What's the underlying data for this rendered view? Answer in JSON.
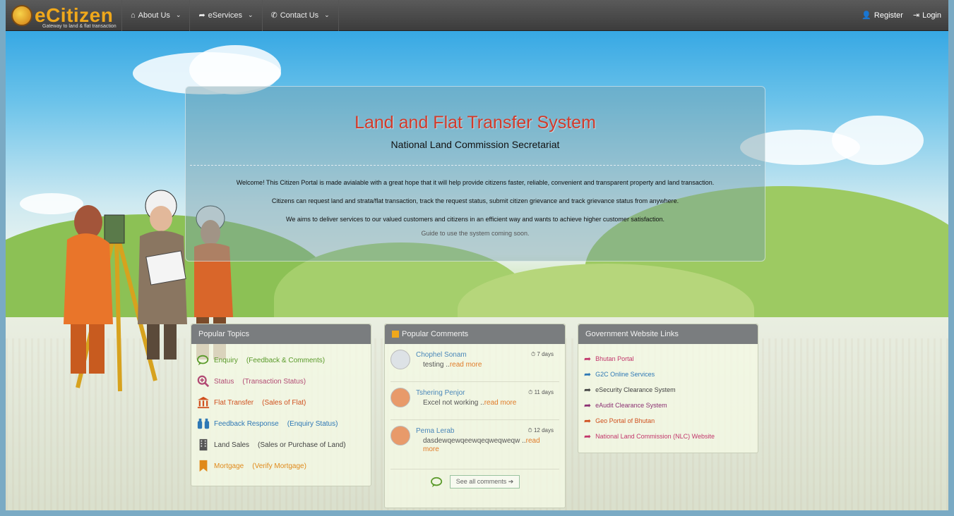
{
  "nav": {
    "brand_name": "eCitizen",
    "brand_tagline": "Gateway to land & flat transaction",
    "menu": [
      {
        "label": "About Us"
      },
      {
        "label": "eServices"
      },
      {
        "label": "Contact Us"
      }
    ],
    "register_label": "Register",
    "login_label": "Login"
  },
  "intro": {
    "title": "Land and Flat Transfer System",
    "subtitle": "National Land Commission Secretariat",
    "paragraphs": [
      "Welcome! This Citizen Portal is made avialable with a great hope that it will help provide citizens faster, reliable, convenient and transparent property and land transaction.",
      "Citizens can request land and strata/flat transaction, track the request status, submit citizen grievance and track grievance status from anywhere.",
      "We aims to deliver services to our valued customers and citizens in an efficient way and wants to achieve higher customer satisfaction."
    ],
    "guide": "Guide to use the system coming soon."
  },
  "popular_topics": {
    "heading": "Popular Topics",
    "items": [
      {
        "label": "Enquiry",
        "sub": "(Feedback & Comments)",
        "color": "#5a9a2a",
        "icon": "chat-icon"
      },
      {
        "label": "Status",
        "sub": "(Transaction Status)",
        "color": "#b24b74",
        "icon": "zoom-icon"
      },
      {
        "label": "Flat Transfer",
        "sub": "(Sales of Flat)",
        "color": "#d0501e",
        "icon": "bank-icon"
      },
      {
        "label": "Feedback Response",
        "sub": "(Enquiry Status)",
        "color": "#2e78b5",
        "icon": "binoculars-icon"
      },
      {
        "label": "Land Sales",
        "sub": "(Sales or Purchase of Land)",
        "color": "#555555",
        "icon": "building-icon"
      },
      {
        "label": "Mortgage",
        "sub": "(Verify Mortgage)",
        "color": "#e08a1b",
        "icon": "bookmark-icon"
      }
    ]
  },
  "popular_comments": {
    "heading": "Popular Comments",
    "items": [
      {
        "name": "Chophel Sonam",
        "days": "7 days",
        "text": "testing ..",
        "more": "read more"
      },
      {
        "name": "Tshering Penjor",
        "days": "11 days",
        "text": "Excel not working ..",
        "more": "read more"
      },
      {
        "name": "Pema Lerab",
        "days": "12 days",
        "text": "dasdewqewqeewqeqweqweqw ..",
        "more": "read more"
      }
    ],
    "see_all": "See all comments"
  },
  "gov_links": {
    "heading": "Government Website Links",
    "items": [
      {
        "label": "Bhutan Portal",
        "color": "#c2366b"
      },
      {
        "label": "G2C Online Services",
        "color": "#2e78b5"
      },
      {
        "label": "eSecurity Clearance System",
        "color": "#444444"
      },
      {
        "label": "eAudit Clearance System",
        "color": "#8b2f72"
      },
      {
        "label": "Geo Portal of Bhutan",
        "color": "#d0501e"
      },
      {
        "label": "National Land Commission (NLC) Website",
        "color": "#c2366b"
      }
    ]
  }
}
